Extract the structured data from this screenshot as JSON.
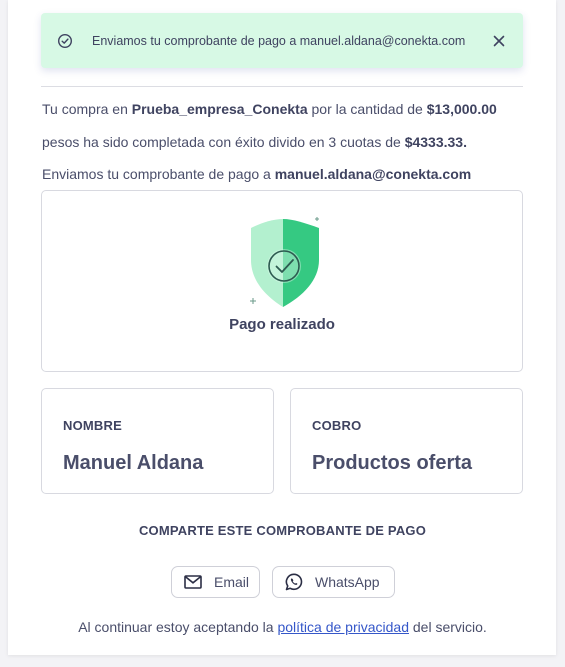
{
  "toast": {
    "icon": "check-circle-icon",
    "message": "Enviamos tu comprobante de pago a manuel.aldana@conekta.com",
    "close_icon": "close-icon",
    "background": "#d7f9e5"
  },
  "summary": {
    "line1_prefix": "Tu compra en ",
    "company": "Prueba_empresa_Conekta",
    "line1_middle": " por la cantidad de ",
    "amount": "$13,000.00",
    "line2_prefix": "pesos ha sido completada con éxito divido en 3 cuotas de ",
    "installment": "$4333.33.",
    "line3_prefix": "Enviamos tu comprobante de pago a ",
    "email": "manuel.aldana@conekta.com"
  },
  "status": {
    "icon": "shield-check-icon",
    "title": "Pago realizado",
    "accent": "#b8f0d0"
  },
  "details": {
    "name_label": "NOMBRE",
    "name_value": "Manuel Aldana",
    "charge_label": "COBRO",
    "charge_value": "Productos oferta"
  },
  "share": {
    "title": "COMPARTE ESTE COMPROBANTE DE PAGO",
    "email_label": "Email",
    "email_icon": "mail-icon",
    "whatsapp_label": "WhatsApp",
    "whatsapp_icon": "whatsapp-icon"
  },
  "footer": {
    "prefix": "Al continuar estoy aceptando la ",
    "link": "política de privacidad",
    "suffix": " del servicio.",
    "link_color": "#3557c9"
  }
}
